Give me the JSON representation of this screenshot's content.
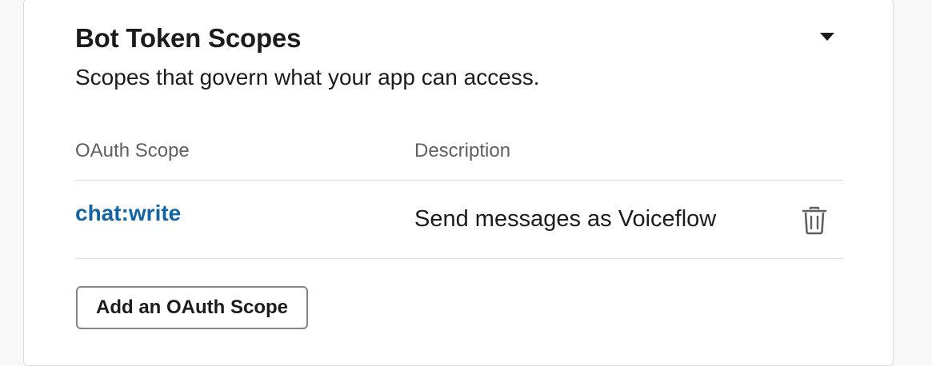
{
  "section": {
    "title": "Bot Token Scopes",
    "subtitle": "Scopes that govern what your app can access.",
    "collapse_icon": "caret-down-icon"
  },
  "table": {
    "columns": [
      "OAuth Scope",
      "Description"
    ],
    "rows": [
      {
        "scope": "chat:write",
        "description": "Send messages as Voiceflow",
        "action_icon": "trash-icon"
      }
    ]
  },
  "actions": {
    "add_scope_label": "Add an OAuth Scope"
  },
  "colors": {
    "link": "#1264a3",
    "text": "#1d1c1d",
    "muted": "#616061",
    "border": "#dddddd"
  }
}
